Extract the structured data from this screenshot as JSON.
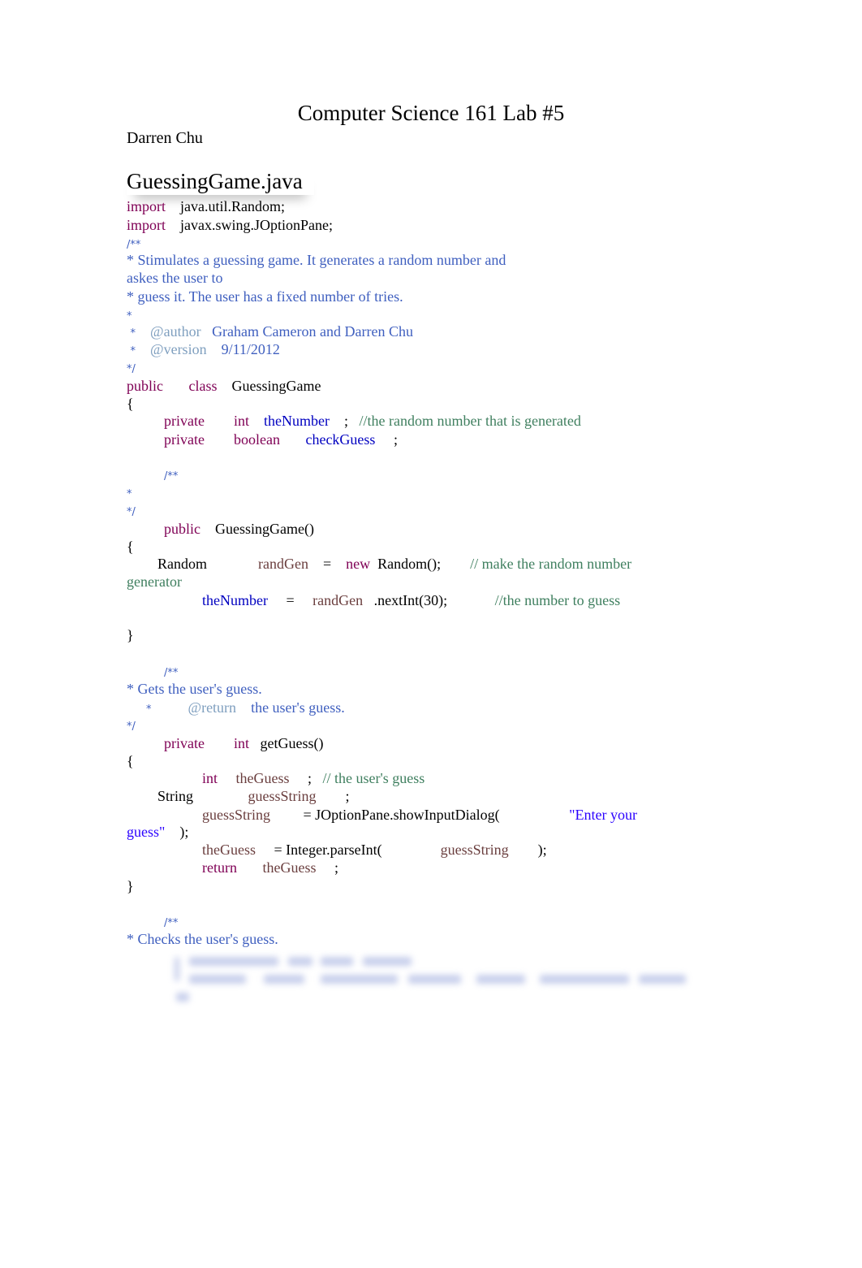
{
  "document": {
    "title": "Computer Science 161 Lab #5",
    "author": "Darren Chu",
    "filename": "GuessingGame.java"
  },
  "code": {
    "l01": {
      "kw": "import",
      "rest": "java.util.Random;"
    },
    "l02": {
      "kw": "import",
      "rest": "javax.swing.JOptionPane;"
    },
    "l03": {
      "text": "/**"
    },
    "l04": {
      "text": "* Stimulates a guessing game. It generates a random number and"
    },
    "l05": {
      "text": "askes the user to"
    },
    "l06": {
      "text": "* guess it. The user has a fixed number of tries."
    },
    "l07": {
      "text": "*"
    },
    "l08": {
      "star": "*",
      "tag": "@author",
      "value": "Graham Cameron and Darren Chu"
    },
    "l09": {
      "star": "*",
      "tag": "@version",
      "value": "9/11/2012"
    },
    "l10": {
      "text": "*/"
    },
    "l11": {
      "kw1": "public",
      "kw2": "class",
      "name": "GuessingGame"
    },
    "l12": {
      "text": "{"
    },
    "l13": {
      "kw1": "private",
      "kw2": "int",
      "field": "theNumber",
      "semi": ";",
      "comment": "//the random number that is generated"
    },
    "l14": {
      "kw1": "private",
      "kw2": "boolean",
      "field": "checkGuess",
      "semi": ";"
    },
    "l15": {
      "text": "/**"
    },
    "l16": {
      "text": "*"
    },
    "l17": {
      "text": "*/"
    },
    "l18": {
      "kw": "public",
      "name": "GuessingGame()"
    },
    "l19": {
      "text": "{"
    },
    "l20": {
      "type": "Random",
      "var": "randGen",
      "eq": "=",
      "kw": "new",
      "call": "Random();",
      "comment": "// make the random number"
    },
    "l21": {
      "text": "generator"
    },
    "l22": {
      "field": "theNumber",
      "eq": "=",
      "var": "randGen",
      "call": ".nextInt(30);",
      "comment": "//the number to guess"
    },
    "l23": {
      "text": "}"
    },
    "l24": {
      "text": "/**"
    },
    "l25": {
      "text": "* Gets the user's guess."
    },
    "l26": {
      "star": "*",
      "tag": "@return",
      "value": "the user's guess."
    },
    "l27": {
      "text": "*/"
    },
    "l28": {
      "kw1": "private",
      "kw2": "int",
      "name": "getGuess()"
    },
    "l29": {
      "text": "{"
    },
    "l30": {
      "kw": "int",
      "var": "theGuess",
      "semi": ";",
      "comment": "// the user's guess"
    },
    "l31": {
      "type": "String",
      "var": "guessString",
      "semi": ";"
    },
    "l32": {
      "var": "guessString",
      "call": "= JOptionPane.showInputDialog(",
      "str": "\"Enter your"
    },
    "l33": {
      "str": "guess\"",
      "close": ");"
    },
    "l34": {
      "var": "theGuess",
      "call": "= Integer.parseInt(",
      "arg": "guessString",
      "close": ");"
    },
    "l35": {
      "kw": "return",
      "var": "theGuess",
      "semi": ";"
    },
    "l36": {
      "text": "}"
    },
    "l37": {
      "text": "/**"
    },
    "l38": {
      "text": "* Checks the user's guess."
    }
  }
}
